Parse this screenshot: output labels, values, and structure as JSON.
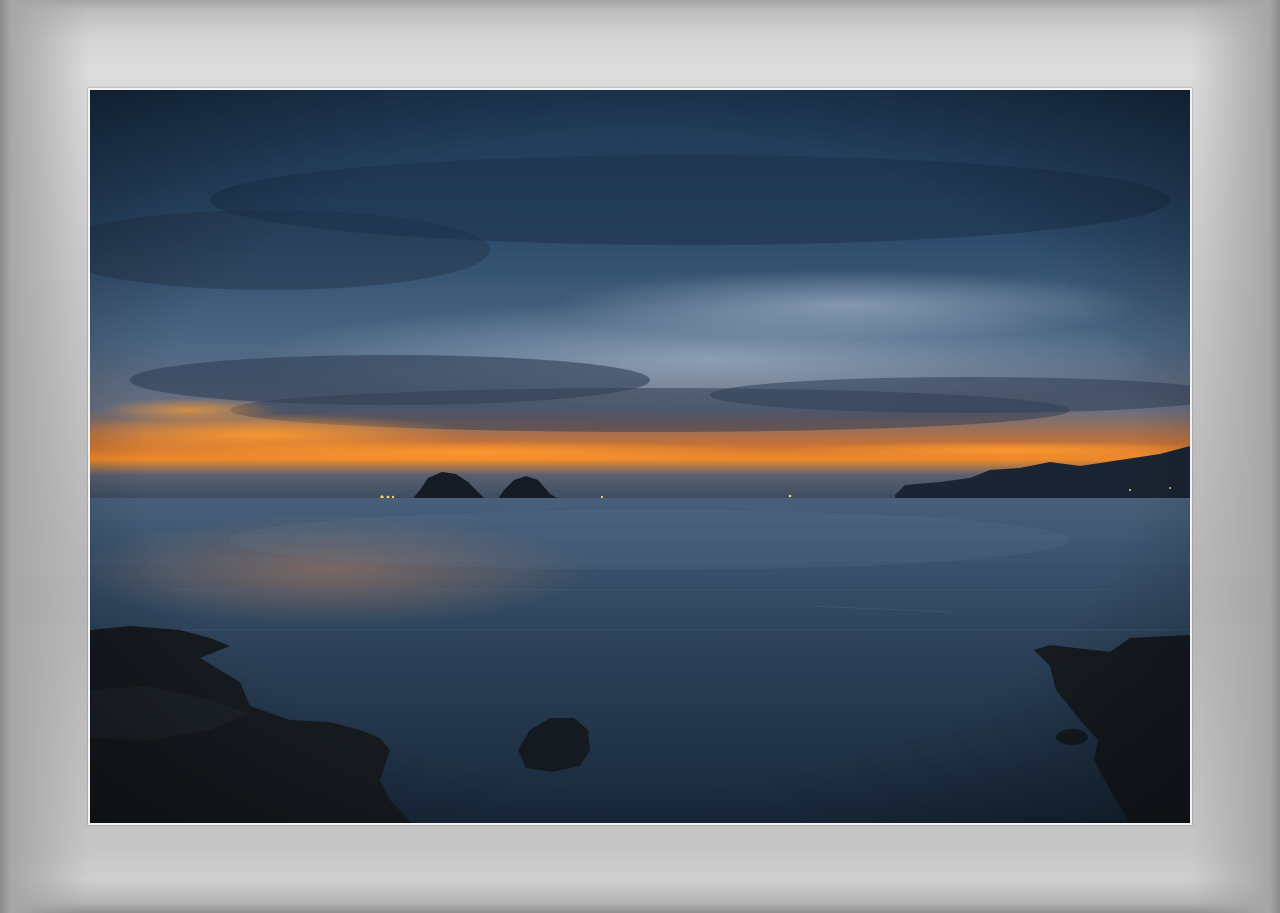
{
  "image": {
    "subject": "dusk-seascape",
    "colors": {
      "mat": "#c9c9c9",
      "photo_border": "#f2f2f2",
      "sky_top": "#1e3550",
      "sky_mid": "#3e5b7a",
      "sky_glow": "#f08a2a",
      "water": "#223448",
      "rock": "#171c22"
    }
  }
}
